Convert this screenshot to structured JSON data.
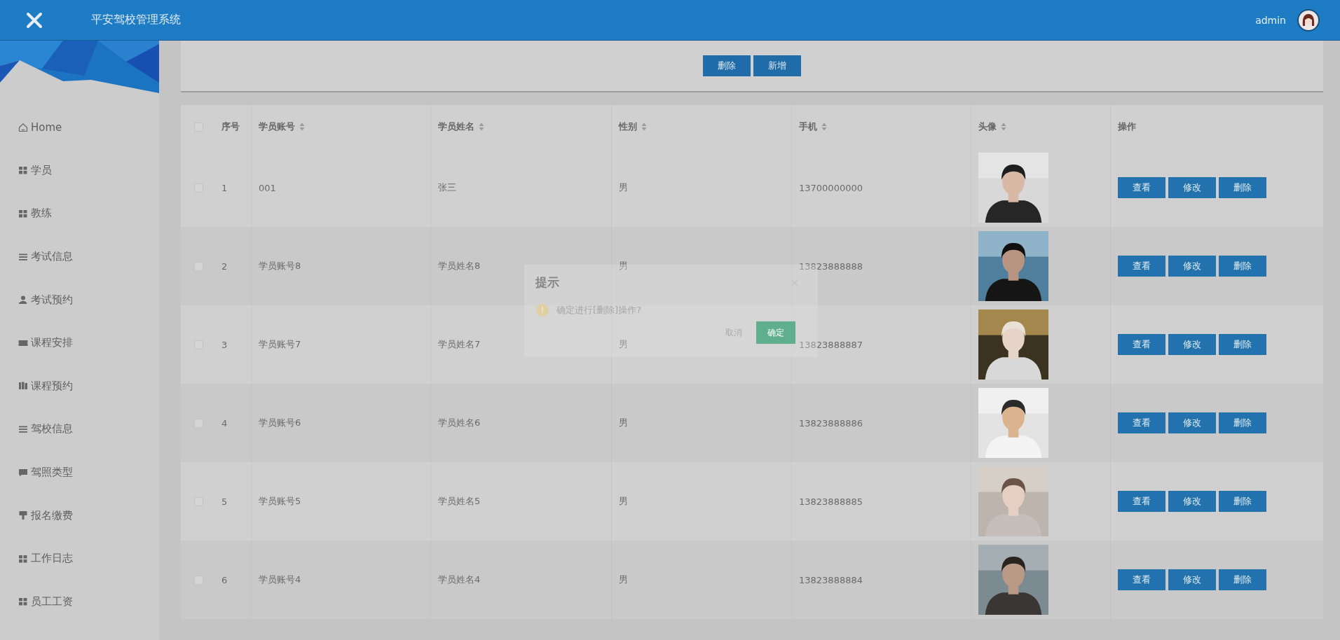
{
  "header": {
    "title": "平安驾校管理系统",
    "user": "admin"
  },
  "sidebar": {
    "items": [
      {
        "label": "Home",
        "kind": "home"
      },
      {
        "label": "学员",
        "kind": "grid"
      },
      {
        "label": "教练",
        "kind": "grid"
      },
      {
        "label": "考试信息",
        "kind": "list"
      },
      {
        "label": "考试预约",
        "kind": "user"
      },
      {
        "label": "课程安排",
        "kind": "ticket"
      },
      {
        "label": "课程预约",
        "kind": "book"
      },
      {
        "label": "驾校信息",
        "kind": "list"
      },
      {
        "label": "驾照类型",
        "kind": "chat"
      },
      {
        "label": "报名缴费",
        "kind": "stamp"
      },
      {
        "label": "工作日志",
        "kind": "grid"
      },
      {
        "label": "员工工资",
        "kind": "grid"
      }
    ]
  },
  "toolbar": {
    "buttons": [
      "删除",
      "新增"
    ]
  },
  "table": {
    "select_all": {
      "checked": false
    },
    "columns": [
      {
        "label": "序号",
        "kind": "plain"
      },
      {
        "label": "学员账号",
        "kind": "sortable"
      },
      {
        "label": "学员姓名",
        "kind": "sortable"
      },
      {
        "label": "性别",
        "kind": "sortable"
      },
      {
        "label": "手机",
        "kind": "sortable"
      },
      {
        "label": "头像",
        "kind": "sortable"
      },
      {
        "label": "操作",
        "kind": "plain"
      }
    ],
    "rows": [
      {
        "checked": false,
        "no": "1",
        "account": "001",
        "name": "张三",
        "gender": "男",
        "phone": "13700000000",
        "actions": [
          "查看",
          "修改",
          "删除"
        ]
      },
      {
        "checked": false,
        "no": "2",
        "account": "学员账号8",
        "name": "学员姓名8",
        "gender": "男",
        "phone": "13823888888",
        "actions": [
          "查看",
          "修改",
          "删除"
        ]
      },
      {
        "checked": false,
        "no": "3",
        "account": "学员账号7",
        "name": "学员姓名7",
        "gender": "男",
        "phone": "13823888887",
        "actions": [
          "查看",
          "修改",
          "删除"
        ]
      },
      {
        "checked": false,
        "no": "4",
        "account": "学员账号6",
        "name": "学员姓名6",
        "gender": "男",
        "phone": "13823888886",
        "actions": [
          "查看",
          "修改",
          "删除"
        ]
      },
      {
        "checked": false,
        "no": "5",
        "account": "学员账号5",
        "name": "学员姓名5",
        "gender": "男",
        "phone": "13823888885",
        "actions": [
          "查看",
          "修改",
          "删除"
        ]
      },
      {
        "checked": false,
        "no": "6",
        "account": "学员账号4",
        "name": "学员姓名4",
        "gender": "男",
        "phone": "13823888884",
        "actions": [
          "查看",
          "修改",
          "删除"
        ]
      }
    ]
  },
  "dialog": {
    "title": "提示",
    "message": "确定进行[删除]操作?",
    "cancel": "取消",
    "confirm": "确定"
  }
}
